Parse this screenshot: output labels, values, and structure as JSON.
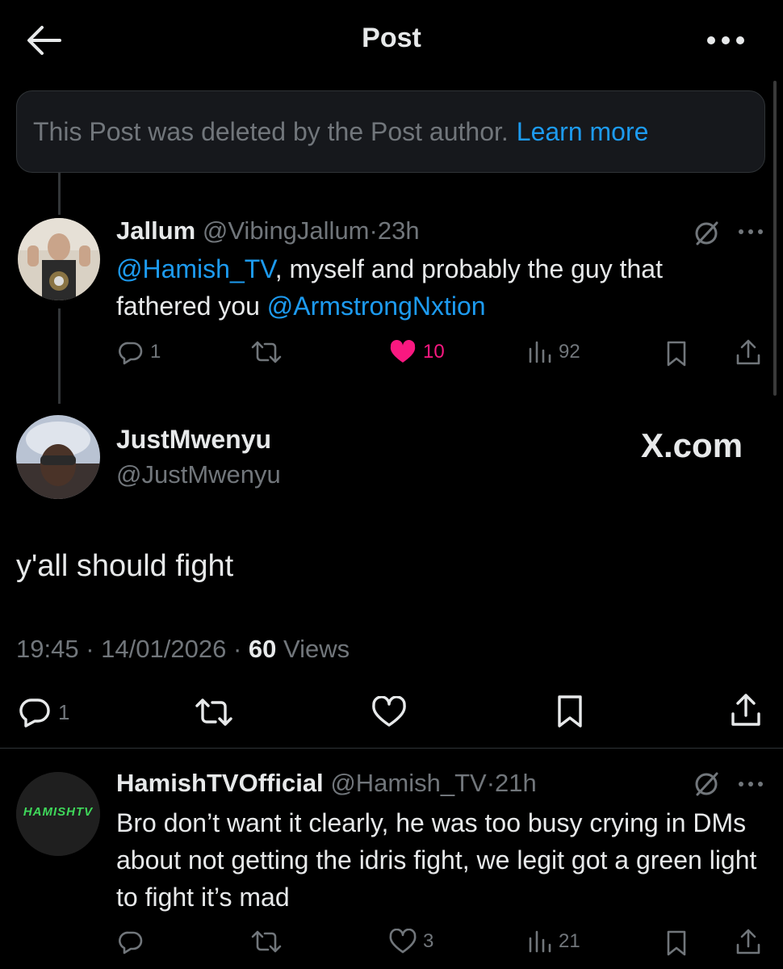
{
  "header": {
    "title": "Post"
  },
  "deleted_notice": {
    "text": "This Post was deleted by the Post author.",
    "link": "Learn more"
  },
  "reply1": {
    "name": "Jallum",
    "handle": "@VibingJallum",
    "sep": "·",
    "time": "23h",
    "text_mention1": "@Hamish_TV",
    "text_part1": ", myself and probably the guy that fathered you ",
    "text_mention2": "@ArmstrongNxtion",
    "replies": "1",
    "likes": "10",
    "views": "92",
    "like_color": "#f91880"
  },
  "main_post": {
    "name": "JustMwenyu",
    "handle": "@JustMwenyu",
    "watermark": "X.com",
    "text": "y'all should fight",
    "time": "19:45",
    "date": "14/01/2026",
    "sep": "·",
    "views_count": "60",
    "views_label": "Views",
    "replies": "1"
  },
  "reply2": {
    "name": "HamishTVOfficial",
    "handle": "@Hamish_TV",
    "sep": "·",
    "time": "21h",
    "text": "Bro don’t want it clearly, he was too busy crying in DMs about not getting the idris fight, we legit got a green light to fight it’s mad",
    "avatar_logo": "HAMISHTV",
    "likes": "3",
    "views": "21"
  },
  "colors": {
    "accent": "#1d9bf0",
    "muted": "#71767b",
    "background": "#000000"
  },
  "icons": [
    "back-arrow-icon",
    "more-icon",
    "reply-icon",
    "repost-icon",
    "like-icon",
    "views-icon",
    "bookmark-icon",
    "share-icon",
    "grok-icon"
  ]
}
